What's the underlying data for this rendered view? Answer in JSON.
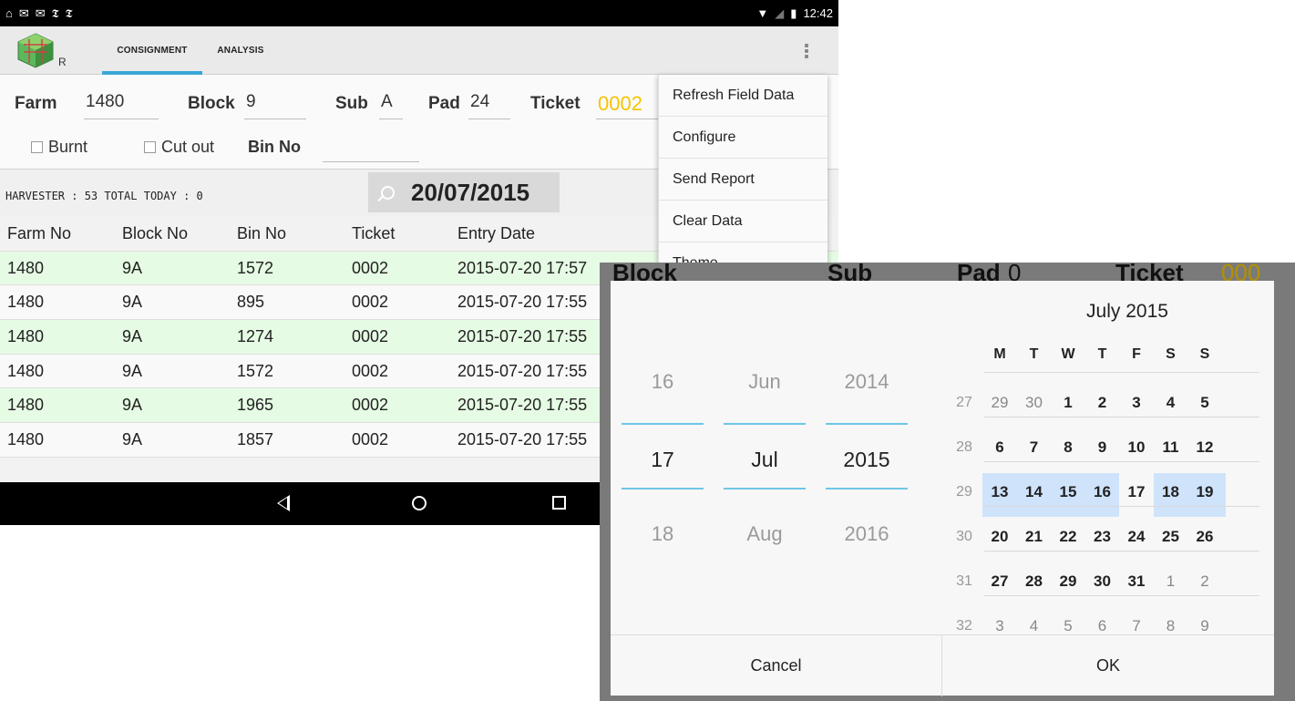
{
  "statusbar": {
    "left_icons": [
      "notification-icon",
      "mail-icon",
      "mail-icon",
      "nyt-icon",
      "nyt-icon"
    ],
    "time": "12:42"
  },
  "app": {
    "logo_letter": "R",
    "tabs": [
      {
        "label": "CONSIGNMENT",
        "active": true
      },
      {
        "label": "ANALYSIS",
        "active": false
      }
    ],
    "accent": "#3aa7d8"
  },
  "form": {
    "farm_label": "Farm",
    "farm_value": "1480",
    "block_label": "Block",
    "block_value": "9",
    "sub_label": "Sub",
    "sub_value": "A",
    "pad_label": "Pad",
    "pad_value": "24",
    "ticket_label": "Ticket",
    "ticket_value": "0002",
    "burnt_label": "Burnt",
    "cutout_label": "Cut out",
    "binno_label": "Bin No"
  },
  "summary": {
    "text": "HARVESTER :  53   TOTAL TODAY : 0",
    "date": "20/07/2015"
  },
  "table": {
    "headers": [
      "Farm No",
      "Block No",
      "Bin No",
      "Ticket",
      "Entry Date"
    ],
    "rows": [
      {
        "farm": "1480",
        "block": "9A",
        "bin": "1572",
        "ticket": "0002",
        "date": "2015-07-20 17:57",
        "color": "green"
      },
      {
        "farm": "1480",
        "block": "9A",
        "bin": "895",
        "ticket": "0002",
        "date": "2015-07-20 17:55",
        "color": "white"
      },
      {
        "farm": "1480",
        "block": "9A",
        "bin": "1274",
        "ticket": "0002",
        "date": "2015-07-20 17:55",
        "color": "green"
      },
      {
        "farm": "1480",
        "block": "9A",
        "bin": "1572",
        "ticket": "0002",
        "date": "2015-07-20 17:55",
        "color": "white"
      },
      {
        "farm": "1480",
        "block": "9A",
        "bin": "1965",
        "ticket": "0002",
        "date": "2015-07-20 17:55",
        "color": "green"
      },
      {
        "farm": "1480",
        "block": "9A",
        "bin": "1857",
        "ticket": "0002",
        "date": "2015-07-20 17:55",
        "color": "white"
      }
    ]
  },
  "menu": {
    "items": [
      "Refresh Field Data",
      "Configure",
      "Send Report",
      "Clear Data",
      "Theme"
    ]
  },
  "dialog_background": {
    "block": "Block",
    "sub": "Sub",
    "pad": "Pad",
    "pad_value": "0",
    "ticket": "Ticket",
    "ticket_value": "000"
  },
  "date_picker": {
    "spinner": {
      "day": {
        "prev": "16",
        "current": "17",
        "next": "18"
      },
      "month": {
        "prev": "Jun",
        "current": "Jul",
        "next": "Aug"
      },
      "year": {
        "prev": "2014",
        "current": "2015",
        "next": "2016"
      }
    },
    "calendar": {
      "title": "July 2015",
      "weekdays": [
        "M",
        "T",
        "W",
        "T",
        "F",
        "S",
        "S"
      ],
      "weeks": [
        {
          "week": "27",
          "days": [
            "29",
            "30",
            "1",
            "2",
            "3",
            "4",
            "5"
          ]
        },
        {
          "week": "28",
          "days": [
            "6",
            "7",
            "8",
            "9",
            "10",
            "11",
            "12"
          ]
        },
        {
          "week": "29",
          "days": [
            "13",
            "14",
            "15",
            "16",
            "17",
            "18",
            "19"
          ]
        },
        {
          "week": "30",
          "days": [
            "20",
            "21",
            "22",
            "23",
            "24",
            "25",
            "26"
          ]
        },
        {
          "week": "31",
          "days": [
            "27",
            "28",
            "29",
            "30",
            "31",
            "1",
            "2"
          ]
        },
        {
          "week": "32",
          "days": [
            "3",
            "4",
            "5",
            "6",
            "7",
            "8",
            "9"
          ]
        }
      ],
      "selected_highlight": "#cfe3fb"
    },
    "cancel_label": "Cancel",
    "ok_label": "OK"
  }
}
